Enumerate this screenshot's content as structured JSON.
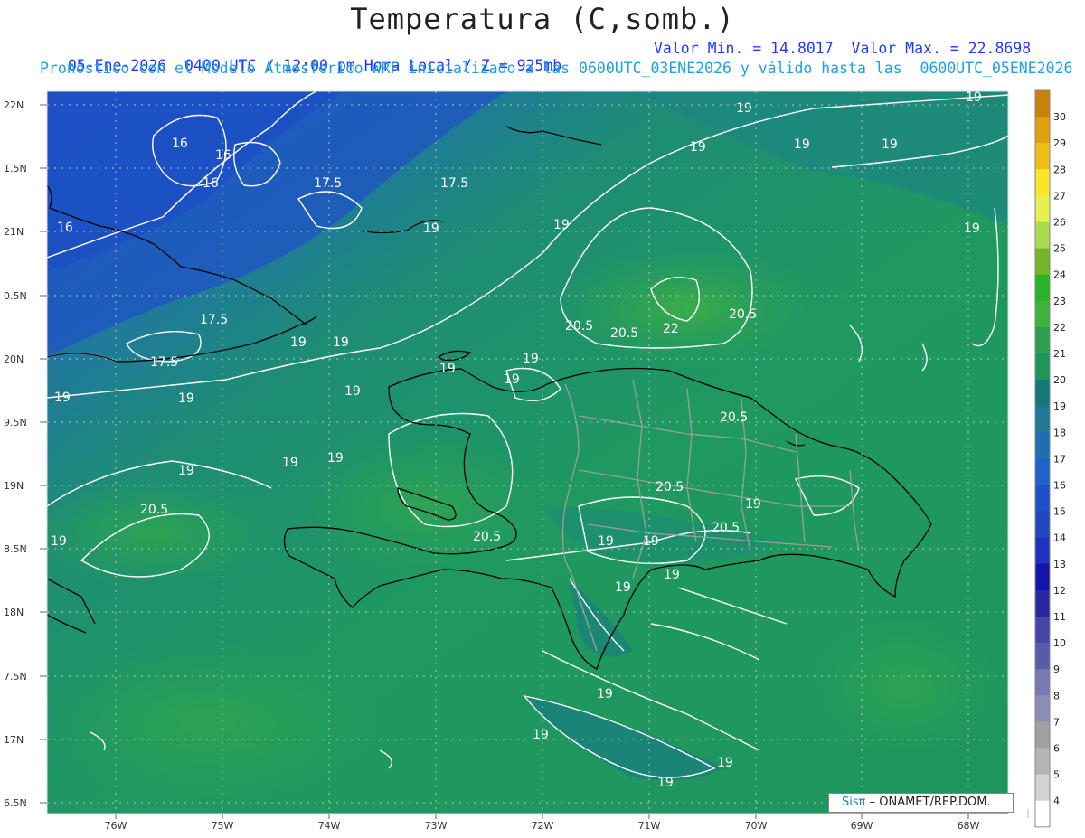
{
  "header": {
    "title": "Temperatura (C,somb.)",
    "subtitle_left": "05-Ene-2026  0400 UTC / 12:00 pm Hora Local / Z = 925mb",
    "subtitle_right": "Valor Min. = 14.8017  Valor Max. = 22.8698",
    "subtitle_model": "Pronóstico con el Modelo Atmosferico WRF inicializado a las 0600UTC_03ENE2026 y válido hasta las  0600UTC_05ENE2026"
  },
  "map": {
    "lat_labels": [
      "22N",
      "1.5N",
      "21N",
      "0.5N",
      "20N",
      "9.5N",
      "19N",
      "8.5N",
      "18N",
      "7.5N",
      "17N",
      "6.5N"
    ],
    "lon_labels": [
      "76W",
      "75W",
      "74W",
      "73W",
      "72W",
      "71W",
      "70W",
      "69W",
      "68W"
    ],
    "contour_labels": [
      "16",
      "16",
      "16",
      "16",
      "17.5",
      "17.5",
      "17.5",
      "17.5",
      "19",
      "19",
      "19",
      "19",
      "19",
      "19",
      "19",
      "19",
      "19",
      "19",
      "19",
      "19",
      "19",
      "19",
      "19",
      "19",
      "19",
      "19",
      "19",
      "19",
      "19",
      "20.5",
      "20.5",
      "20.5",
      "20.5",
      "20.5",
      "20.5",
      "20.5",
      "22"
    ]
  },
  "legend": {
    "values": [
      "30",
      "29",
      "28",
      "27",
      "26",
      "25",
      "24",
      "23",
      "22",
      "21",
      "20",
      "19",
      "18",
      "17",
      "16",
      "15",
      "14",
      "13",
      "12",
      "11",
      "10",
      "9",
      "8",
      "7",
      "6",
      "5",
      "4"
    ],
    "colors": [
      "#c8820a",
      "#e0a010",
      "#f0be18",
      "#fae628",
      "#e6f050",
      "#aadc50",
      "#78b428",
      "#28b428",
      "#3cb43c",
      "#2ca050",
      "#1e965a",
      "#147878",
      "#1e7896",
      "#1e6eb4",
      "#1e64c8",
      "#1e50c8",
      "#1e46be",
      "#1e32be",
      "#1414aa",
      "#2828a0",
      "#4646aa",
      "#5a5aaa",
      "#7878b4",
      "#8c8cb4",
      "#a0a0a0",
      "#b4b4b4",
      "#d2d2d2",
      "#ffffff"
    ]
  },
  "credit": {
    "brand": "Sisπ",
    "text": " – ONAMET/REP.DOM."
  }
}
